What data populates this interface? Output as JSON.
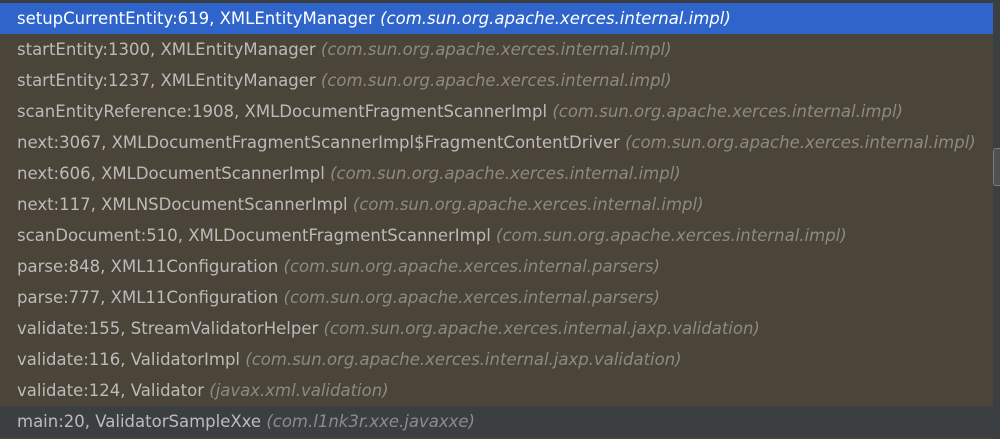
{
  "frames": [
    {
      "method": "setupCurrentEntity:619, XMLEntityManager",
      "package": "(com.sun.org.apache.xerces.internal.impl)",
      "state": "selected"
    },
    {
      "method": "startEntity:1300, XMLEntityManager",
      "package": "(com.sun.org.apache.xerces.internal.impl)",
      "state": "library"
    },
    {
      "method": "startEntity:1237, XMLEntityManager",
      "package": "(com.sun.org.apache.xerces.internal.impl)",
      "state": "library"
    },
    {
      "method": "scanEntityReference:1908, XMLDocumentFragmentScannerImpl",
      "package": "(com.sun.org.apache.xerces.internal.impl)",
      "state": "library"
    },
    {
      "method": "next:3067, XMLDocumentFragmentScannerImpl$FragmentContentDriver",
      "package": "(com.sun.org.apache.xerces.internal.impl)",
      "state": "library"
    },
    {
      "method": "next:606, XMLDocumentScannerImpl",
      "package": "(com.sun.org.apache.xerces.internal.impl)",
      "state": "library"
    },
    {
      "method": "next:117, XMLNSDocumentScannerImpl",
      "package": "(com.sun.org.apache.xerces.internal.impl)",
      "state": "library"
    },
    {
      "method": "scanDocument:510, XMLDocumentFragmentScannerImpl",
      "package": "(com.sun.org.apache.xerces.internal.impl)",
      "state": "library"
    },
    {
      "method": "parse:848, XML11Configuration",
      "package": "(com.sun.org.apache.xerces.internal.parsers)",
      "state": "library"
    },
    {
      "method": "parse:777, XML11Configuration",
      "package": "(com.sun.org.apache.xerces.internal.parsers)",
      "state": "library"
    },
    {
      "method": "validate:155, StreamValidatorHelper",
      "package": "(com.sun.org.apache.xerces.internal.jaxp.validation)",
      "state": "library"
    },
    {
      "method": "validate:116, ValidatorImpl",
      "package": "(com.sun.org.apache.xerces.internal.jaxp.validation)",
      "state": "library"
    },
    {
      "method": "validate:124, Validator",
      "package": "(javax.xml.validation)",
      "state": "library"
    },
    {
      "method": "main:20, ValidatorSampleXxe",
      "package": "(com.l1nk3r.xxe.javaxxe)",
      "state": "user"
    }
  ],
  "colors": {
    "selected": "#2f65ca",
    "library_bg": "#4a4538",
    "user_bg": "#3c3f41"
  }
}
